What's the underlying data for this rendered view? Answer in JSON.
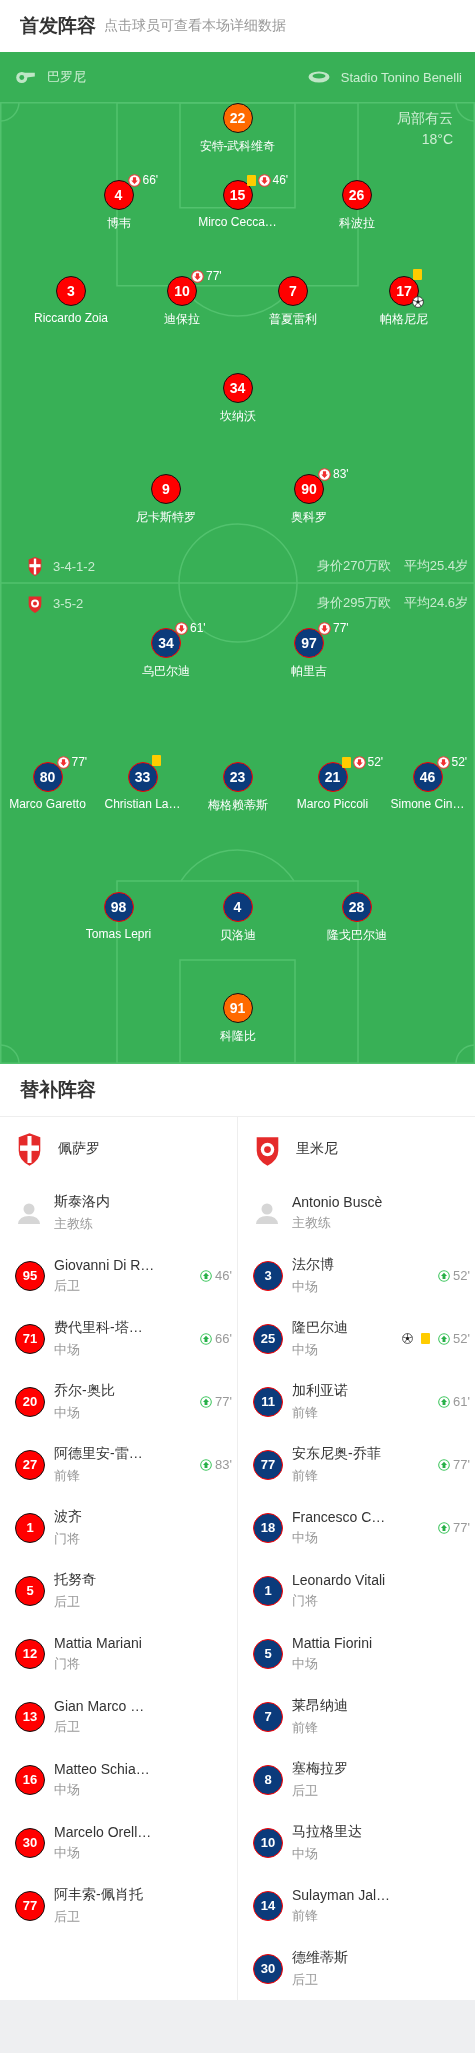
{
  "header": {
    "title": "首发阵容",
    "hint": "点击球员可查看本场详细数据"
  },
  "match_info": {
    "referee": "巴罗尼",
    "stadium": "Stadio Tonino Benelli",
    "weather": "局部有云",
    "temperature": "18°C"
  },
  "home": {
    "formation": "3-4-1-2",
    "market_value": "身价270万欧",
    "average_age": "平均25.4岁",
    "lines": [
      [
        {
          "number": "22",
          "name": "安特-武科维奇",
          "kind": "goalkeeper"
        }
      ],
      [
        {
          "number": "4",
          "name": "博韦",
          "kind": "outfield",
          "events": [
            {
              "kind": "sub_off",
              "minute": "66'"
            }
          ]
        },
        {
          "number": "15",
          "name": "Mirco Cecca…",
          "kind": "outfield",
          "events": [
            {
              "kind": "yellow_card"
            },
            {
              "kind": "sub_off",
              "minute": "46'"
            }
          ]
        },
        {
          "number": "26",
          "name": "科波拉",
          "kind": "outfield"
        }
      ],
      [
        {
          "number": "3",
          "name": "Riccardo Zoia",
          "kind": "outfield"
        },
        {
          "number": "10",
          "name": "迪保拉",
          "kind": "outfield",
          "events": [
            {
              "kind": "sub_off",
              "minute": "77'"
            }
          ]
        },
        {
          "number": "7",
          "name": "普夏雷利",
          "kind": "outfield"
        },
        {
          "number": "17",
          "name": "帕格尼尼",
          "kind": "outfield",
          "events": [
            {
              "kind": "yellow_card"
            },
            {
              "kind": "goal"
            }
          ]
        }
      ],
      [
        {
          "number": "34",
          "name": "坎纳沃",
          "kind": "outfield"
        }
      ],
      [
        {
          "number": "9",
          "name": "尼卡斯特罗",
          "kind": "outfield"
        },
        {
          "number": "90",
          "name": "奥科罗",
          "kind": "outfield",
          "events": [
            {
              "kind": "sub_off",
              "minute": "83'"
            }
          ]
        }
      ]
    ]
  },
  "away": {
    "formation": "3-5-2",
    "market_value": "身价295万欧",
    "average_age": "平均24.6岁",
    "lines": [
      [
        {
          "number": "34",
          "name": "乌巴尔迪",
          "kind": "outfield",
          "events": [
            {
              "kind": "sub_off",
              "minute": "61'"
            }
          ]
        },
        {
          "number": "97",
          "name": "帕里吉",
          "kind": "outfield",
          "events": [
            {
              "kind": "sub_off",
              "minute": "77'"
            }
          ]
        }
      ],
      [
        {
          "number": "80",
          "name": "Marco Garetto",
          "kind": "outfield",
          "events": [
            {
              "kind": "sub_off",
              "minute": "77'"
            }
          ]
        },
        {
          "number": "33",
          "name": "Christian La…",
          "kind": "outfield",
          "events": [
            {
              "kind": "yellow_card"
            }
          ]
        },
        {
          "number": "23",
          "name": "梅格赖蒂斯",
          "kind": "outfield"
        },
        {
          "number": "21",
          "name": "Marco Piccoli",
          "kind": "outfield",
          "events": [
            {
              "kind": "yellow_card"
            },
            {
              "kind": "sub_off",
              "minute": "52'"
            }
          ]
        },
        {
          "number": "46",
          "name": "Simone Cin…",
          "kind": "outfield",
          "events": [
            {
              "kind": "sub_off",
              "minute": "52'"
            }
          ]
        }
      ],
      [
        {
          "number": "98",
          "name": "Tomas Lepri",
          "kind": "outfield"
        },
        {
          "number": "4",
          "name": "贝洛迪",
          "kind": "outfield"
        },
        {
          "number": "28",
          "name": "隆戈巴尔迪",
          "kind": "outfield"
        }
      ],
      [
        {
          "number": "91",
          "name": "科隆比",
          "kind": "goalkeeper"
        }
      ]
    ]
  },
  "substitutes": {
    "title": "替补阵容",
    "teams": [
      {
        "kind": "home",
        "name": "佩萨罗",
        "coach": "斯泰洛内",
        "coach_role": "主教练",
        "players": [
          {
            "number": "95",
            "name": "Giovanni Di R…",
            "position": "后卫",
            "events": [
              {
                "kind": "sub_on",
                "minute": "46'"
              }
            ]
          },
          {
            "number": "71",
            "name": "费代里科-塔…",
            "position": "中场",
            "events": [
              {
                "kind": "sub_on",
                "minute": "66'"
              }
            ]
          },
          {
            "number": "20",
            "name": "乔尔-奥比",
            "position": "中场",
            "events": [
              {
                "kind": "sub_on",
                "minute": "77'"
              }
            ]
          },
          {
            "number": "27",
            "name": "阿德里安-雷…",
            "position": "前锋",
            "events": [
              {
                "kind": "sub_on",
                "minute": "83'"
              }
            ]
          },
          {
            "number": "1",
            "name": "波齐",
            "position": "门将"
          },
          {
            "number": "5",
            "name": "托努奇",
            "position": "后卫"
          },
          {
            "number": "12",
            "name": "Mattia Mariani",
            "position": "门将"
          },
          {
            "number": "13",
            "name": "Gian Marco …",
            "position": "后卫"
          },
          {
            "number": "16",
            "name": "Matteo Schia…",
            "position": "中场"
          },
          {
            "number": "30",
            "name": "Marcelo Orell…",
            "position": "中场"
          },
          {
            "number": "77",
            "name": "阿丰索-佩肖托",
            "position": "后卫"
          }
        ]
      },
      {
        "kind": "away",
        "name": "里米尼",
        "coach": "Antonio Buscè",
        "coach_role": "主教练",
        "players": [
          {
            "number": "3",
            "name": "法尔博",
            "position": "中场",
            "events": [
              {
                "kind": "sub_on",
                "minute": "52'"
              }
            ]
          },
          {
            "number": "25",
            "name": "隆巴尔迪",
            "position": "中场",
            "events": [
              {
                "kind": "goal"
              },
              {
                "kind": "yellow_card"
              },
              {
                "kind": "sub_on",
                "minute": "52'"
              }
            ]
          },
          {
            "number": "11",
            "name": "加利亚诺",
            "position": "前锋",
            "events": [
              {
                "kind": "sub_on",
                "minute": "61'"
              }
            ]
          },
          {
            "number": "77",
            "name": "安东尼奥-乔菲",
            "position": "前锋",
            "events": [
              {
                "kind": "sub_on",
                "minute": "77'"
              }
            ]
          },
          {
            "number": "18",
            "name": "Francesco C…",
            "position": "中场",
            "events": [
              {
                "kind": "sub_on",
                "minute": "77'"
              }
            ]
          },
          {
            "number": "1",
            "name": "Leonardo Vitali",
            "position": "门将"
          },
          {
            "number": "5",
            "name": "Mattia Fiorini",
            "position": "中场"
          },
          {
            "number": "7",
            "name": "莱昂纳迪",
            "position": "前锋"
          },
          {
            "number": "8",
            "name": "塞梅拉罗",
            "position": "后卫"
          },
          {
            "number": "10",
            "name": "马拉格里达",
            "position": "中场"
          },
          {
            "number": "14",
            "name": "Sulayman Jal…",
            "position": "前锋"
          },
          {
            "number": "30",
            "name": "德维蒂斯",
            "position": "后卫"
          }
        ]
      }
    ]
  }
}
